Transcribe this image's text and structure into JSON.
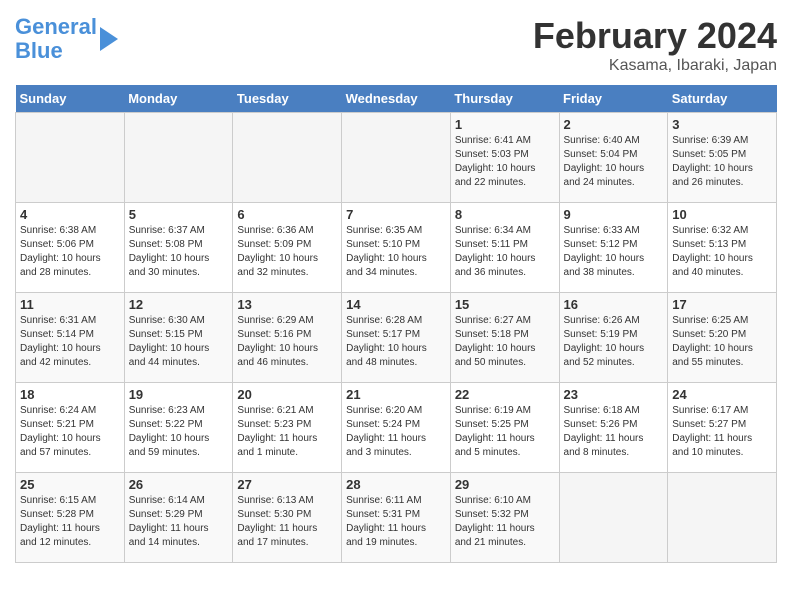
{
  "header": {
    "logo_line1": "General",
    "logo_line2": "Blue",
    "title": "February 2024",
    "subtitle": "Kasama, Ibaraki, Japan"
  },
  "weekdays": [
    "Sunday",
    "Monday",
    "Tuesday",
    "Wednesday",
    "Thursday",
    "Friday",
    "Saturday"
  ],
  "weeks": [
    [
      {
        "day": "",
        "info": ""
      },
      {
        "day": "",
        "info": ""
      },
      {
        "day": "",
        "info": ""
      },
      {
        "day": "",
        "info": ""
      },
      {
        "day": "1",
        "info": "Sunrise: 6:41 AM\nSunset: 5:03 PM\nDaylight: 10 hours\nand 22 minutes."
      },
      {
        "day": "2",
        "info": "Sunrise: 6:40 AM\nSunset: 5:04 PM\nDaylight: 10 hours\nand 24 minutes."
      },
      {
        "day": "3",
        "info": "Sunrise: 6:39 AM\nSunset: 5:05 PM\nDaylight: 10 hours\nand 26 minutes."
      }
    ],
    [
      {
        "day": "4",
        "info": "Sunrise: 6:38 AM\nSunset: 5:06 PM\nDaylight: 10 hours\nand 28 minutes."
      },
      {
        "day": "5",
        "info": "Sunrise: 6:37 AM\nSunset: 5:08 PM\nDaylight: 10 hours\nand 30 minutes."
      },
      {
        "day": "6",
        "info": "Sunrise: 6:36 AM\nSunset: 5:09 PM\nDaylight: 10 hours\nand 32 minutes."
      },
      {
        "day": "7",
        "info": "Sunrise: 6:35 AM\nSunset: 5:10 PM\nDaylight: 10 hours\nand 34 minutes."
      },
      {
        "day": "8",
        "info": "Sunrise: 6:34 AM\nSunset: 5:11 PM\nDaylight: 10 hours\nand 36 minutes."
      },
      {
        "day": "9",
        "info": "Sunrise: 6:33 AM\nSunset: 5:12 PM\nDaylight: 10 hours\nand 38 minutes."
      },
      {
        "day": "10",
        "info": "Sunrise: 6:32 AM\nSunset: 5:13 PM\nDaylight: 10 hours\nand 40 minutes."
      }
    ],
    [
      {
        "day": "11",
        "info": "Sunrise: 6:31 AM\nSunset: 5:14 PM\nDaylight: 10 hours\nand 42 minutes."
      },
      {
        "day": "12",
        "info": "Sunrise: 6:30 AM\nSunset: 5:15 PM\nDaylight: 10 hours\nand 44 minutes."
      },
      {
        "day": "13",
        "info": "Sunrise: 6:29 AM\nSunset: 5:16 PM\nDaylight: 10 hours\nand 46 minutes."
      },
      {
        "day": "14",
        "info": "Sunrise: 6:28 AM\nSunset: 5:17 PM\nDaylight: 10 hours\nand 48 minutes."
      },
      {
        "day": "15",
        "info": "Sunrise: 6:27 AM\nSunset: 5:18 PM\nDaylight: 10 hours\nand 50 minutes."
      },
      {
        "day": "16",
        "info": "Sunrise: 6:26 AM\nSunset: 5:19 PM\nDaylight: 10 hours\nand 52 minutes."
      },
      {
        "day": "17",
        "info": "Sunrise: 6:25 AM\nSunset: 5:20 PM\nDaylight: 10 hours\nand 55 minutes."
      }
    ],
    [
      {
        "day": "18",
        "info": "Sunrise: 6:24 AM\nSunset: 5:21 PM\nDaylight: 10 hours\nand 57 minutes."
      },
      {
        "day": "19",
        "info": "Sunrise: 6:23 AM\nSunset: 5:22 PM\nDaylight: 10 hours\nand 59 minutes."
      },
      {
        "day": "20",
        "info": "Sunrise: 6:21 AM\nSunset: 5:23 PM\nDaylight: 11 hours\nand 1 minute."
      },
      {
        "day": "21",
        "info": "Sunrise: 6:20 AM\nSunset: 5:24 PM\nDaylight: 11 hours\nand 3 minutes."
      },
      {
        "day": "22",
        "info": "Sunrise: 6:19 AM\nSunset: 5:25 PM\nDaylight: 11 hours\nand 5 minutes."
      },
      {
        "day": "23",
        "info": "Sunrise: 6:18 AM\nSunset: 5:26 PM\nDaylight: 11 hours\nand 8 minutes."
      },
      {
        "day": "24",
        "info": "Sunrise: 6:17 AM\nSunset: 5:27 PM\nDaylight: 11 hours\nand 10 minutes."
      }
    ],
    [
      {
        "day": "25",
        "info": "Sunrise: 6:15 AM\nSunset: 5:28 PM\nDaylight: 11 hours\nand 12 minutes."
      },
      {
        "day": "26",
        "info": "Sunrise: 6:14 AM\nSunset: 5:29 PM\nDaylight: 11 hours\nand 14 minutes."
      },
      {
        "day": "27",
        "info": "Sunrise: 6:13 AM\nSunset: 5:30 PM\nDaylight: 11 hours\nand 17 minutes."
      },
      {
        "day": "28",
        "info": "Sunrise: 6:11 AM\nSunset: 5:31 PM\nDaylight: 11 hours\nand 19 minutes."
      },
      {
        "day": "29",
        "info": "Sunrise: 6:10 AM\nSunset: 5:32 PM\nDaylight: 11 hours\nand 21 minutes."
      },
      {
        "day": "",
        "info": ""
      },
      {
        "day": "",
        "info": ""
      }
    ]
  ]
}
